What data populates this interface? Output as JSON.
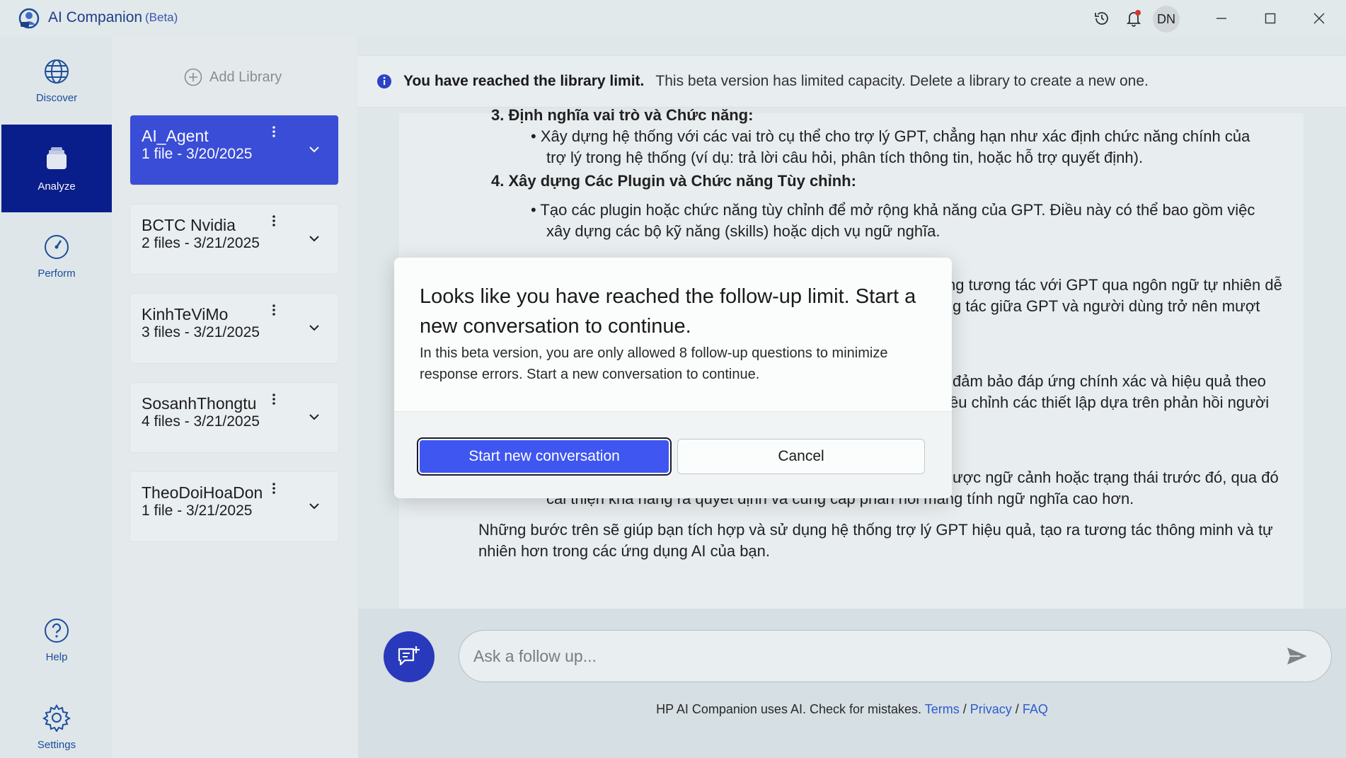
{
  "titlebar": {
    "app_name": "AI Companion",
    "beta_tag": "(Beta)",
    "user_initials": "DN",
    "icons": [
      "history-icon",
      "bell-icon",
      "minimize-icon",
      "maximize-icon",
      "close-icon"
    ]
  },
  "nav": {
    "items": [
      {
        "label": "Discover",
        "icon": "globe-icon"
      },
      {
        "label": "Analyze",
        "icon": "stack-icon",
        "active": true
      },
      {
        "label": "Perform",
        "icon": "gauge-icon"
      },
      {
        "label": "Help",
        "icon": "help-icon"
      },
      {
        "label": "Settings",
        "icon": "gear-icon"
      }
    ]
  },
  "libraries": {
    "add_label": "Add Library",
    "items": [
      {
        "name": "AI_Agent",
        "meta": "1 file - 3/20/2025",
        "selected": true
      },
      {
        "name": "BCTC Nvidia",
        "meta": "2 files - 3/21/2025"
      },
      {
        "name": "KinhTeViMo",
        "meta": "3 files - 3/21/2025"
      },
      {
        "name": "SosanhThongtu",
        "meta": "4 files - 3/21/2025"
      },
      {
        "name": "TheoDoiHoaDon",
        "meta": "1 file - 3/21/2025"
      }
    ]
  },
  "banner": {
    "bold": "You have reached the library limit.",
    "text": "This beta version has limited capacity. Delete a library to create a new one."
  },
  "answer": {
    "l1": "3.  Định nghĩa vai trò và Chức năng:",
    "l2": "•  Xây dựng hệ thống với các vai trò cụ thể cho trợ lý GPT, chẳng hạn như xác định chức năng chính của",
    "l3": "trợ lý trong hệ thống (ví dụ: trả lời câu hỏi, phân tích thông tin, hoặc hỗ trợ quyết định).",
    "l4": "4.  Xây dựng Các Plugin và Chức năng Tùy chỉnh:",
    "l5": "•  Tạo các plugin hoặc chức năng tùy chỉnh để mở rộng khả năng của GPT. Điều này có thể bao gồm việc",
    "l6": "xây dựng các bộ kỹ năng (skills) hoặc dịch vụ ngữ nghĩa.",
    "l7": "ng tương tác với GPT qua ngôn ngữ tự nhiên dễ",
    "l8": "g tác giữa GPT và người dùng trở nên mượt",
    "l9": "đảm bảo đáp ứng chính xác và hiệu quả theo",
    "l10": "ều chỉnh các thiết lập dựa trên phản hồi người",
    "l11": "ược ngữ cảnh hoặc trạng thái trước đó, qua đó",
    "l12": "cải thiện khả năng ra quyết định và cung cấp phản hồi mang tính ngữ nghĩa cao hơn.",
    "l13": "Những bước trên sẽ giúp bạn tích hợp và sử dụng hệ thống trợ lý GPT hiệu quả, tạo ra tương tác thông minh và tự",
    "l14": "nhiên hơn trong các ứng dụng AI của bạn."
  },
  "composer": {
    "placeholder": "Ask a follow up...",
    "footer_text": "HP AI Companion uses AI. Check for mistakes.",
    "link_terms": "Terms",
    "link_privacy": "Privacy",
    "link_faq": "FAQ",
    "sep": "/"
  },
  "dialog": {
    "title": "Looks like you have reached the follow-up limit. Start a new conversation to continue.",
    "body": "In this beta version, you are only allowed 8 follow-up questions to minimize response errors. Start a new conversation to continue.",
    "primary_label": "Start new conversation",
    "secondary_label": "Cancel"
  },
  "colors": {
    "accent": "#3f56f0",
    "nav_active": "#0b1f8e",
    "link": "#2d5ed4",
    "info": "#2d44c8"
  }
}
